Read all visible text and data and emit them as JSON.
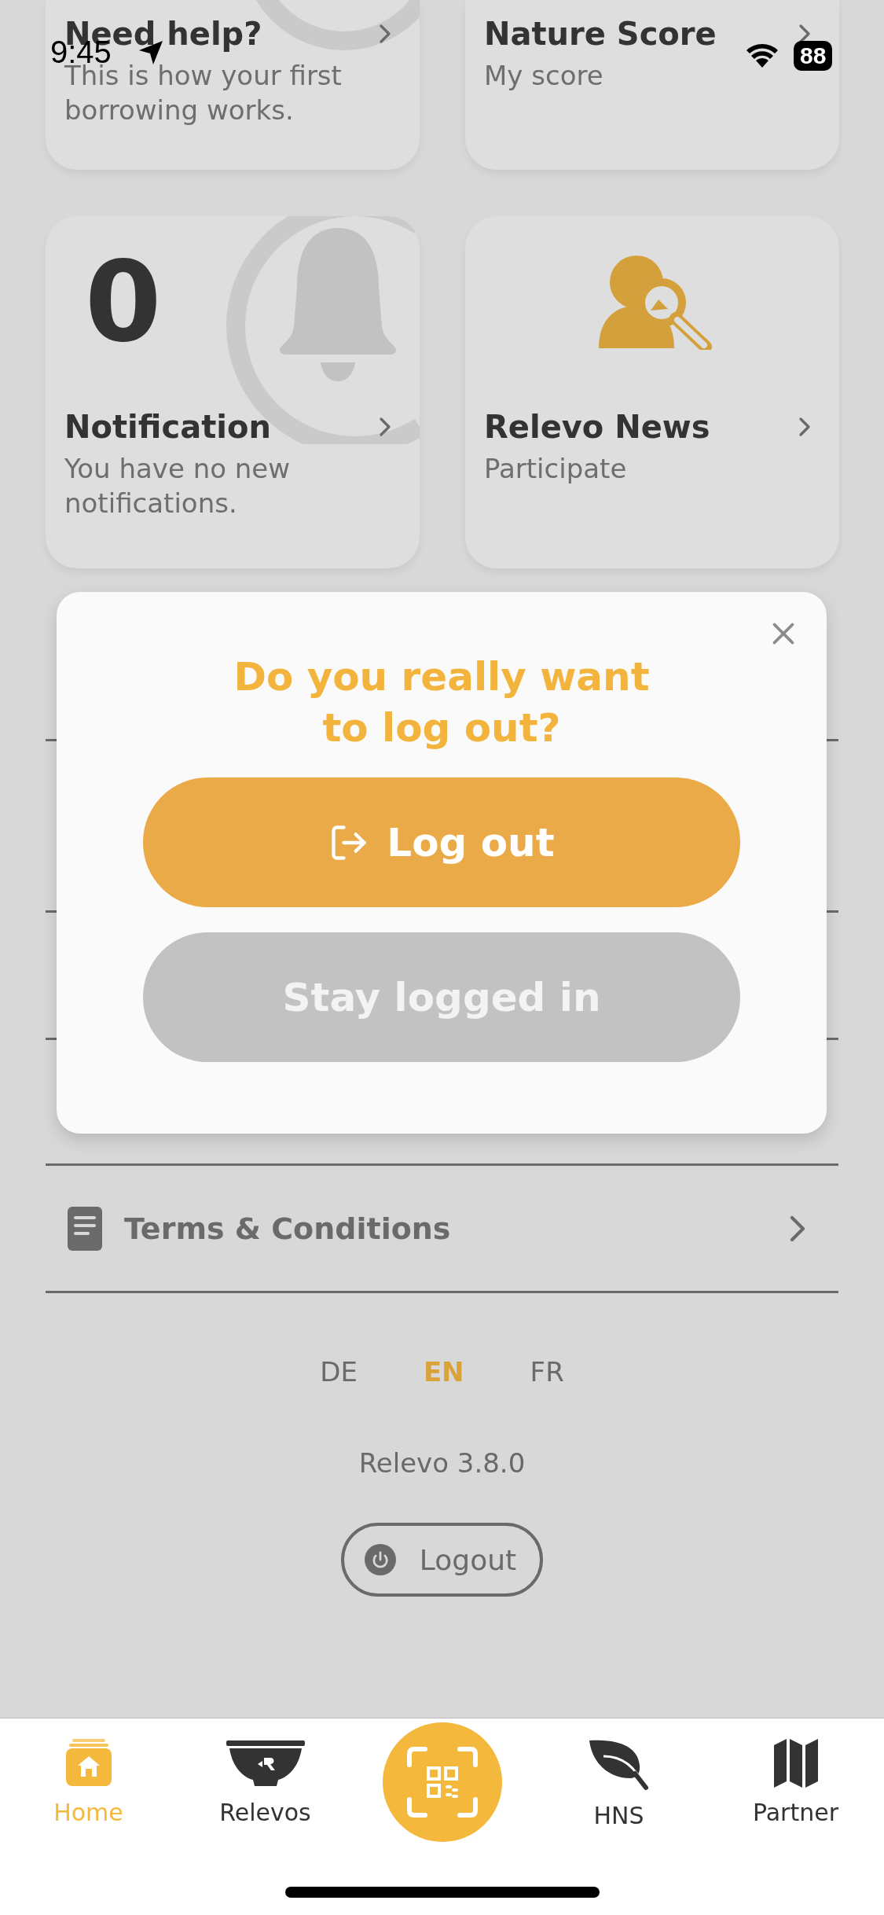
{
  "status_bar": {
    "time": "9:45",
    "battery": "88"
  },
  "cards": [
    {
      "kind": "help",
      "title": "Need help?",
      "subtitle": "This is how your first borrowing works."
    },
    {
      "kind": "score",
      "title": "Nature Score",
      "subtitle": "My score"
    },
    {
      "kind": "notification",
      "count": "0",
      "title": "Notification",
      "subtitle": "You have no new notifications."
    },
    {
      "kind": "news",
      "title": "Relevo News",
      "subtitle": "Participate"
    }
  ],
  "dialog": {
    "title": "Do you really want\nto log out?",
    "confirm": "Log out",
    "cancel": "Stay logged in"
  },
  "menu_items": [
    {
      "label": "Terms & Conditions"
    }
  ],
  "languages": [
    {
      "label": "DE",
      "selected": false
    },
    {
      "label": "EN",
      "selected": true
    },
    {
      "label": "FR",
      "selected": false
    }
  ],
  "version": "Relevo 3.8.0",
  "logout": "Logout",
  "tab_bar": [
    {
      "kind": "home",
      "label": "Home",
      "selected": true
    },
    {
      "kind": "relevos",
      "label": "Relevos",
      "selected": false
    },
    {
      "kind": "scan",
      "selected": false
    },
    {
      "kind": "hns",
      "label": "HNS",
      "selected": false
    },
    {
      "kind": "partner",
      "label": "Partner",
      "selected": false
    }
  ]
}
